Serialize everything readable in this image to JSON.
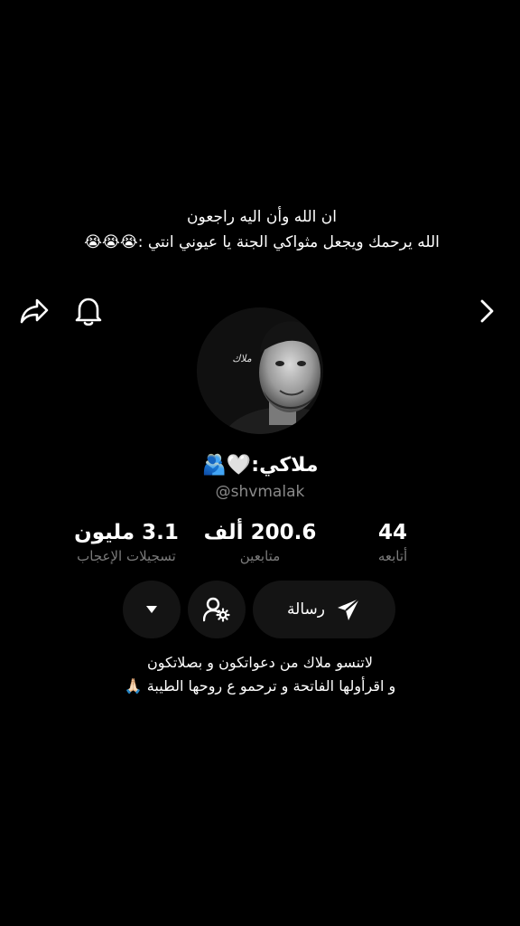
{
  "caption": {
    "line1": "ان الله وأن اليه راجعون",
    "line2": "الله يرحمك ويجعل مثواكي الجنة يا عيوني انتي :😭😭😭"
  },
  "icons": {
    "share": "share-icon",
    "bell": "bell-icon",
    "next": "chevron-right-icon",
    "dropdown": "triangle-down-icon",
    "add_friend": "person-gear-icon",
    "send": "paper-plane-icon"
  },
  "profile": {
    "avatar_signature": "ملاك",
    "display_name": "ملاكي:🤍🫂",
    "username": "@shvmalak"
  },
  "stats": {
    "likes": {
      "value": "3.1 مليون",
      "label": "تسجيلات الإعجاب"
    },
    "followers": {
      "value": "200.6 ألف",
      "label": "متابعين"
    },
    "following": {
      "value": "44",
      "label": "أتابعه"
    }
  },
  "actions": {
    "message_label": "رسالة"
  },
  "bio": {
    "line1": "لاتنسو ملاك من دعواتكون و بصلاتكون",
    "line2": "و اقرأولها الفاتحة و ترحمو ع روحها الطيبة 🙏🏻"
  },
  "colors": {
    "background": "#000000",
    "text": "#ffffff",
    "muted": "#7a7a7a",
    "button_bg": "#141414"
  }
}
